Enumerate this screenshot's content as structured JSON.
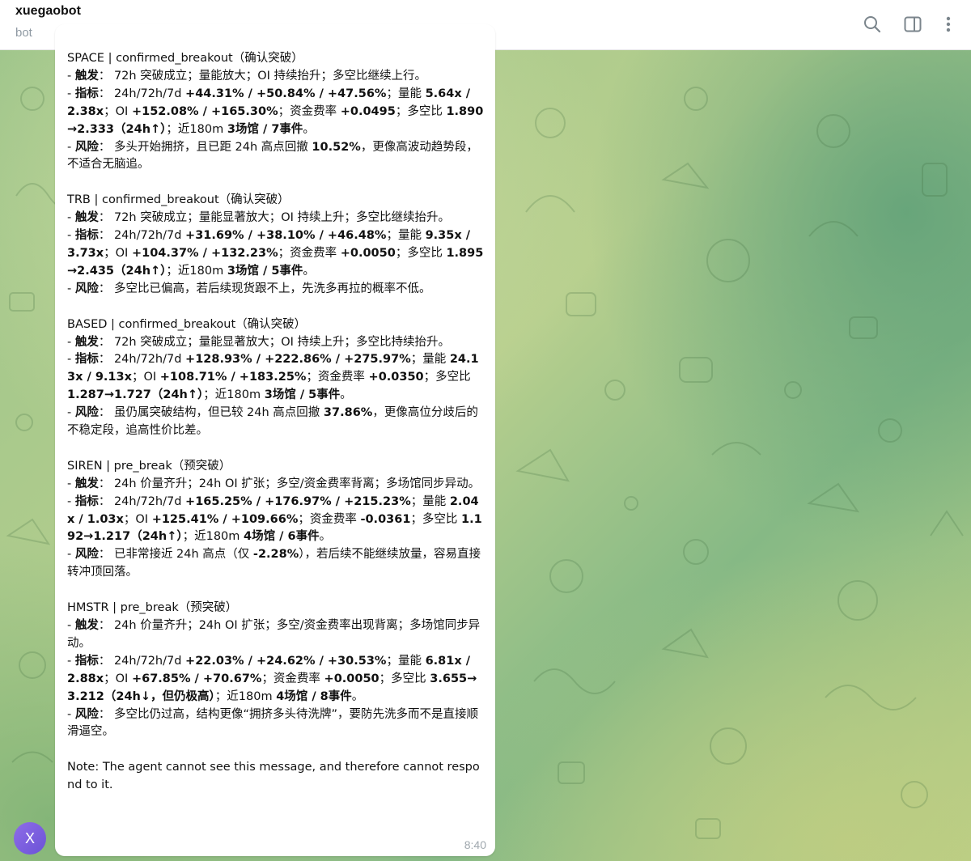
{
  "header": {
    "title": "xuegaobot",
    "status": "bot",
    "icons": [
      "search-icon",
      "sidebar-panel-icon",
      "more-vertical-icon"
    ]
  },
  "message": {
    "sender_initial": "X",
    "time": "8:40",
    "blocks": [
      {
        "heading": "SPACE | confirmed_breakout（确认突破）",
        "lines": [
          [
            {
              "t": "- "
            },
            {
              "t": "触发",
              "b": true
            },
            {
              "t": "： 72h 突破成立；量能放大；OI 持续抬升；多空比继续上行。"
            }
          ],
          [
            {
              "t": "- "
            },
            {
              "t": "指标",
              "b": true
            },
            {
              "t": "： 24h/72h/7d "
            },
            {
              "t": "+44.31% / +50.84% / +47.56%",
              "b": true
            },
            {
              "t": "；量能 "
            },
            {
              "t": "5.64x / 2.38x",
              "b": true
            },
            {
              "t": "；OI "
            },
            {
              "t": "+152.08% / +165.30%",
              "b": true
            },
            {
              "t": "；资金费率 "
            },
            {
              "t": "+0.0495",
              "b": true
            },
            {
              "t": "；多空比 "
            },
            {
              "t": "1.890→2.333（24h↑）",
              "b": true
            },
            {
              "t": "；近180m "
            },
            {
              "t": "3场馆 / 7事件",
              "b": true
            },
            {
              "t": "。"
            }
          ],
          [
            {
              "t": "- "
            },
            {
              "t": "风险",
              "b": true
            },
            {
              "t": "： 多头开始拥挤，且已距 24h 高点回撤 "
            },
            {
              "t": "10.52%",
              "b": true
            },
            {
              "t": "，更像高波动趋势段，不适合无脑追。"
            }
          ]
        ]
      },
      {
        "heading": "TRB | confirmed_breakout（确认突破）",
        "lines": [
          [
            {
              "t": "- "
            },
            {
              "t": "触发",
              "b": true
            },
            {
              "t": "： 72h 突破成立；量能显著放大；OI 持续上升；多空比继续抬升。"
            }
          ],
          [
            {
              "t": "- "
            },
            {
              "t": "指标",
              "b": true
            },
            {
              "t": "： 24h/72h/7d "
            },
            {
              "t": "+31.69% / +38.10% / +46.48%",
              "b": true
            },
            {
              "t": "；量能 "
            },
            {
              "t": "9.35x / 3.73x",
              "b": true
            },
            {
              "t": "；OI "
            },
            {
              "t": "+104.37% / +132.23%",
              "b": true
            },
            {
              "t": "；资金费率 "
            },
            {
              "t": "+0.0050",
              "b": true
            },
            {
              "t": "；多空比 "
            },
            {
              "t": "1.895→2.435（24h↑）",
              "b": true
            },
            {
              "t": "；近180m "
            },
            {
              "t": "3场馆 / 5事件",
              "b": true
            },
            {
              "t": "。"
            }
          ],
          [
            {
              "t": "- "
            },
            {
              "t": "风险",
              "b": true
            },
            {
              "t": "： 多空比已偏高，若后续现货跟不上，先洗多再拉的概率不低。"
            }
          ]
        ]
      },
      {
        "heading": "BASED | confirmed_breakout（确认突破）",
        "lines": [
          [
            {
              "t": "- "
            },
            {
              "t": "触发",
              "b": true
            },
            {
              "t": "： 72h 突破成立；量能显著放大；OI 持续上升；多空比持续抬升。"
            }
          ],
          [
            {
              "t": "- "
            },
            {
              "t": "指标",
              "b": true
            },
            {
              "t": "： 24h/72h/7d "
            },
            {
              "t": "+128.93% / +222.86% / +275.97%",
              "b": true
            },
            {
              "t": "；量能 "
            },
            {
              "t": "24.13x / 9.13x",
              "b": true
            },
            {
              "t": "；OI "
            },
            {
              "t": "+108.71% / +183.25%",
              "b": true
            },
            {
              "t": "；资金费率 "
            },
            {
              "t": "+0.0350",
              "b": true
            },
            {
              "t": "；多空比 "
            },
            {
              "t": "1.287→1.727（24h↑）",
              "b": true
            },
            {
              "t": "；近180m "
            },
            {
              "t": "3场馆 / 5事件",
              "b": true
            },
            {
              "t": "。"
            }
          ],
          [
            {
              "t": "- "
            },
            {
              "t": "风险",
              "b": true
            },
            {
              "t": "： 虽仍属突破结构，但已较 24h 高点回撤 "
            },
            {
              "t": "37.86%",
              "b": true
            },
            {
              "t": "，更像高位分歧后的不稳定段，追高性价比差。"
            }
          ]
        ]
      },
      {
        "heading": "SIREN | pre_break（预突破）",
        "lines": [
          [
            {
              "t": "- "
            },
            {
              "t": "触发",
              "b": true
            },
            {
              "t": "： 24h 价量齐升；24h OI 扩张；多空/资金费率背离；多场馆同步异动。"
            }
          ],
          [
            {
              "t": "- "
            },
            {
              "t": "指标",
              "b": true
            },
            {
              "t": "： 24h/72h/7d "
            },
            {
              "t": "+165.25% / +176.97% / +215.23%",
              "b": true
            },
            {
              "t": "；量能 "
            },
            {
              "t": "2.04x / 1.03x",
              "b": true
            },
            {
              "t": "；OI "
            },
            {
              "t": "+125.41% / +109.66%",
              "b": true
            },
            {
              "t": "；资金费率 "
            },
            {
              "t": "-0.0361",
              "b": true
            },
            {
              "t": "；多空比 "
            },
            {
              "t": "1.192→1.217（24h↑）",
              "b": true
            },
            {
              "t": "；近180m "
            },
            {
              "t": "4场馆 / 6事件",
              "b": true
            },
            {
              "t": "。"
            }
          ],
          [
            {
              "t": "- "
            },
            {
              "t": "风险",
              "b": true
            },
            {
              "t": "： 已非常接近 24h 高点（仅 "
            },
            {
              "t": "-2.28%",
              "b": true
            },
            {
              "t": "），若后续不能继续放量，容易直接转冲顶回落。"
            }
          ]
        ]
      },
      {
        "heading": "HMSTR | pre_break（预突破）",
        "lines": [
          [
            {
              "t": "- "
            },
            {
              "t": "触发",
              "b": true
            },
            {
              "t": "： 24h 价量齐升；24h OI 扩张；多空/资金费率出现背离；多场馆同步异动。"
            }
          ],
          [
            {
              "t": "- "
            },
            {
              "t": "指标",
              "b": true
            },
            {
              "t": "： 24h/72h/7d "
            },
            {
              "t": "+22.03% / +24.62% / +30.53%",
              "b": true
            },
            {
              "t": "；量能 "
            },
            {
              "t": "6.81x / 2.88x",
              "b": true
            },
            {
              "t": "；OI "
            },
            {
              "t": "+67.85% / +70.67%",
              "b": true
            },
            {
              "t": "；资金费率 "
            },
            {
              "t": "+0.0050",
              "b": true
            },
            {
              "t": "；多空比 "
            },
            {
              "t": "3.655→3.212（24h↓，但仍极高）",
              "b": true
            },
            {
              "t": "；近180m "
            },
            {
              "t": "4场馆 / 8事件",
              "b": true
            },
            {
              "t": "。"
            }
          ],
          [
            {
              "t": "- "
            },
            {
              "t": "风险",
              "b": true
            },
            {
              "t": "： 多空比仍过高，结构更像“拥挤多头待洗牌”，要防先洗多而不是直接顺滑逼空。"
            }
          ]
        ]
      }
    ],
    "note": "Note: The agent cannot see this message, and therefore cannot respond to it."
  },
  "colors": {
    "header_bg": "#ffffff",
    "bubble_bg": "#ffffff",
    "avatar": "#7c5ee0",
    "muted": "#8f9aa3"
  }
}
